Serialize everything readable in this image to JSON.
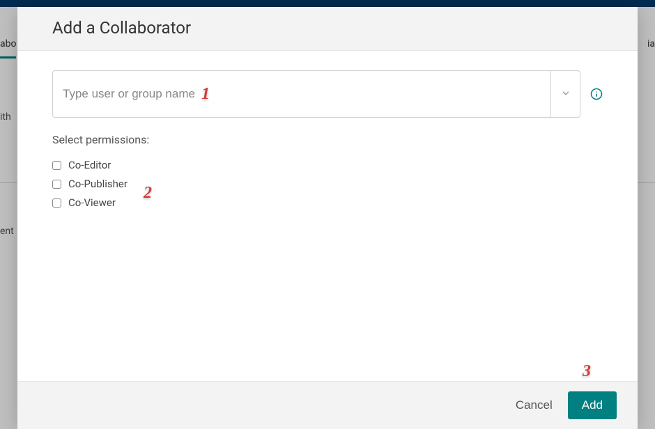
{
  "backdrop": {
    "tab_left": "abo",
    "tab_right": "ia",
    "text1": "ith",
    "text2": "ent"
  },
  "dialog": {
    "title": "Add a Collaborator",
    "search_placeholder": "Type user or group name",
    "permissions_label": "Select permissions:",
    "permissions": [
      {
        "label": "Co-Editor"
      },
      {
        "label": "Co-Publisher"
      },
      {
        "label": "Co-Viewer"
      }
    ],
    "cancel_label": "Cancel",
    "add_label": "Add"
  },
  "annotations": {
    "a1": "1",
    "a2": "2",
    "a3": "3"
  }
}
